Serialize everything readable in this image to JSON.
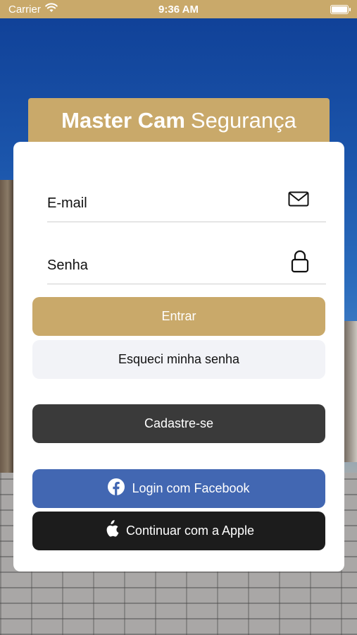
{
  "status_bar": {
    "carrier": "Carrier",
    "time": "9:36 AM"
  },
  "header": {
    "title_bold": "Master Cam",
    "title_regular": "Segurança"
  },
  "form": {
    "email": {
      "placeholder": "E-mail",
      "value": ""
    },
    "password": {
      "placeholder": "Senha",
      "value": ""
    }
  },
  "buttons": {
    "login": "Entrar",
    "forgot": "Esqueci minha senha",
    "signup": "Cadastre-se",
    "facebook": "Login com Facebook",
    "apple": "Continuar com a Apple"
  },
  "icons": {
    "wifi": "wifi-icon",
    "battery": "battery-icon",
    "email": "envelope-icon",
    "password": "lock-icon",
    "facebook": "facebook-icon",
    "apple": "apple-icon"
  },
  "colors": {
    "brand_gold": "#c9a96a",
    "facebook_blue": "#4267b2",
    "signup_dark": "#3a3a3a",
    "apple_black": "#1c1c1c",
    "forgot_bg": "#f2f3f7"
  }
}
